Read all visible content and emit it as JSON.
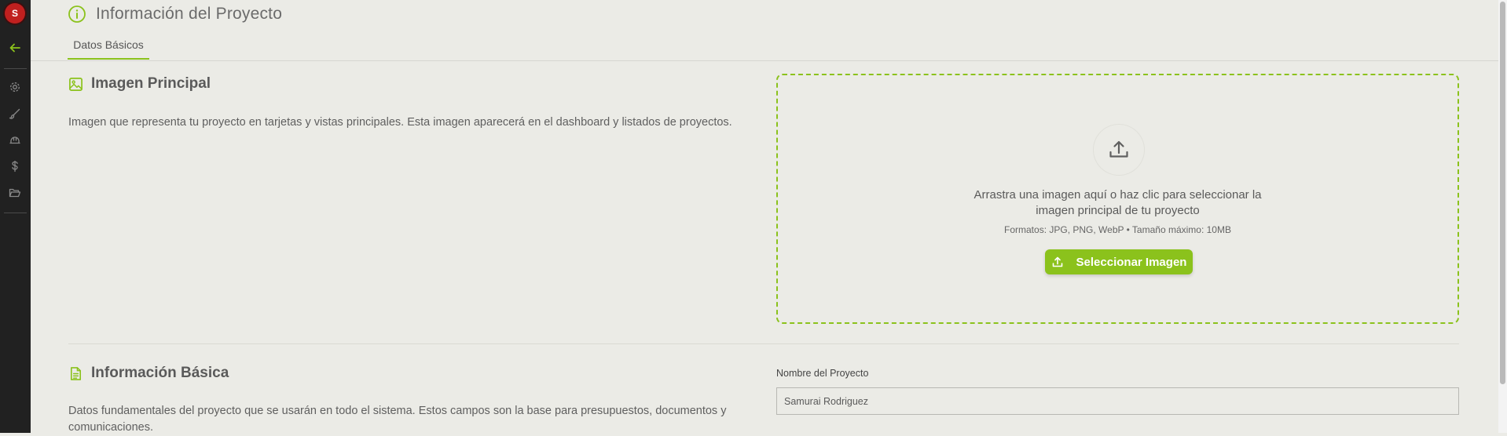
{
  "sidebar": {
    "avatar_initial": "S",
    "icons": [
      "back-arrow-icon",
      "gear-icon",
      "brush-icon",
      "hard-hat-icon",
      "dollar-icon",
      "folder-open-icon"
    ],
    "accent": "#8bc21c"
  },
  "header": {
    "title": "Información del Proyecto",
    "tabs": [
      {
        "label": "Datos Básicos",
        "active": true
      }
    ]
  },
  "image_section": {
    "title": "Imagen Principal",
    "description": "Imagen que representa tu proyecto en tarjetas y vistas principales. Esta imagen aparecerá en el dashboard y listados de proyectos.",
    "dropzone": {
      "line1": "Arrastra una imagen aquí o haz clic para seleccionar la",
      "line2": "imagen principal de tu proyecto",
      "formats": "Formatos: JPG, PNG, WebP • Tamaño máximo: 10MB",
      "button_label": "Seleccionar Imagen"
    }
  },
  "basic_section": {
    "title": "Información Básica",
    "description_line1": "Datos fundamentales del proyecto que se usarán en todo el sistema. Estos campos son la base para presupuestos, documentos y",
    "description_line2": "comunicaciones.",
    "project_name_label": "Nombre del Proyecto",
    "project_name_value": "Samurai Rodriguez"
  },
  "colors": {
    "accent": "#8bc21c",
    "sidebar_bg": "#212121",
    "page_bg": "#ebebe6",
    "avatar_bg": "#c0201f"
  }
}
